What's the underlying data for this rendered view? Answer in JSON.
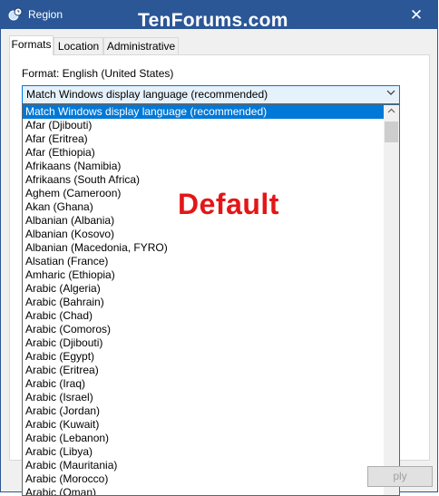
{
  "window": {
    "title": "Region",
    "close_glyph": "✕"
  },
  "watermark": "TenForums.com",
  "tabs": [
    {
      "label": "Formats",
      "active": true
    },
    {
      "label": "Location",
      "active": false
    },
    {
      "label": "Administrative",
      "active": false
    }
  ],
  "format": {
    "label": "Format: English (United States)",
    "selected_value": "Match Windows display language (recommended)"
  },
  "dropdown_options": [
    "Match Windows display language (recommended)",
    "Afar (Djibouti)",
    "Afar (Eritrea)",
    "Afar (Ethiopia)",
    "Afrikaans (Namibia)",
    "Afrikaans (South Africa)",
    "Aghem (Cameroon)",
    "Akan (Ghana)",
    "Albanian (Albania)",
    "Albanian (Kosovo)",
    "Albanian (Macedonia, FYRO)",
    "Alsatian (France)",
    "Amharic (Ethiopia)",
    "Arabic (Algeria)",
    "Arabic (Bahrain)",
    "Arabic (Chad)",
    "Arabic (Comoros)",
    "Arabic (Djibouti)",
    "Arabic (Egypt)",
    "Arabic (Eritrea)",
    "Arabic (Iraq)",
    "Arabic (Israel)",
    "Arabic (Jordan)",
    "Arabic (Kuwait)",
    "Arabic (Lebanon)",
    "Arabic (Libya)",
    "Arabic (Mauritania)",
    "Arabic (Morocco)",
    "Arabic (Oman)"
  ],
  "annotation": "Default",
  "apply_button_partial": "ply",
  "colors": {
    "titlebar": "#2b5797",
    "selection": "#0078d7",
    "annotation": "#e41616"
  },
  "icons": {
    "app": "globe-clock-icon",
    "close": "close-icon",
    "combo_arrow": "chevron-down-icon",
    "scroll_up": "arrow-up-icon"
  }
}
